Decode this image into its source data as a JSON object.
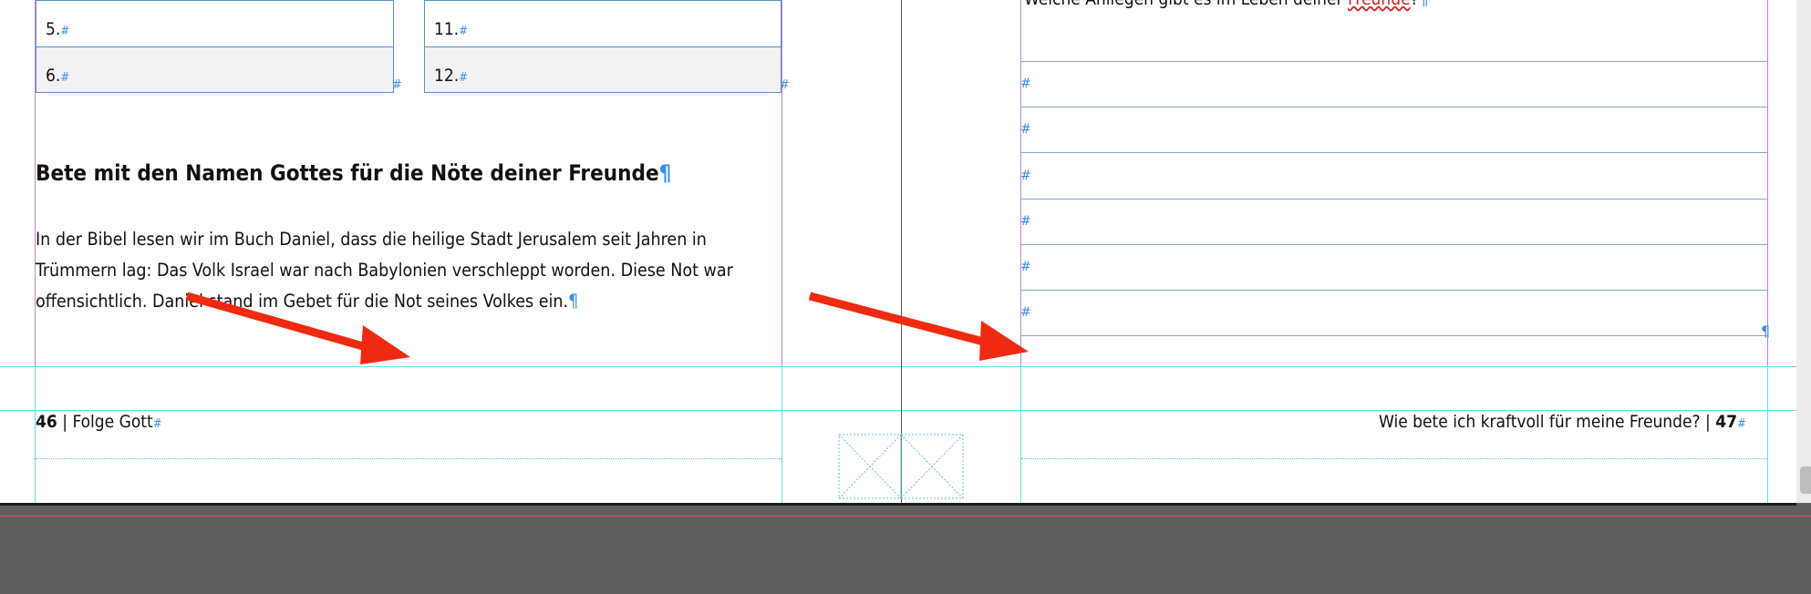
{
  "table": {
    "cells": [
      {
        "label": "5."
      },
      {
        "label": "11."
      },
      {
        "label": "6."
      },
      {
        "label": "12."
      }
    ]
  },
  "article": {
    "heading": "Bete mit den Namen Gottes für die Nöte deiner Freunde",
    "body_lines": [
      "In der Bibel lesen wir im Buch Daniel, dass die heilige Stadt Jerusalem seit Jahren in",
      "Trümmern lag: Das Volk Israel war nach Babylonien verschleppt worden. Diese Not war",
      "offensichtlich. Daniel stand im Gebet für die Not seines Volkes ein."
    ]
  },
  "right_page": {
    "truncated_line": "Welche Anliegen gibt es im Leben deiner",
    "truncated_word": "Freunde"
  },
  "footer": {
    "left_page_number": "46",
    "left_separator": "|",
    "left_title": "Folge Gott",
    "right_title": "Wie bete ich kraftvoll für meine Freunde?",
    "right_separator": "|",
    "right_page_number": "47"
  },
  "marks": {
    "hash": "#",
    "pilcrow": "¶"
  },
  "colors": {
    "arrow": "#f02a10",
    "margin_guide": "#c77ee0",
    "column_guide": "#5fe0ea",
    "frame_stroke": "#5a8fd0",
    "pasteboard": "#5e5e5e"
  }
}
